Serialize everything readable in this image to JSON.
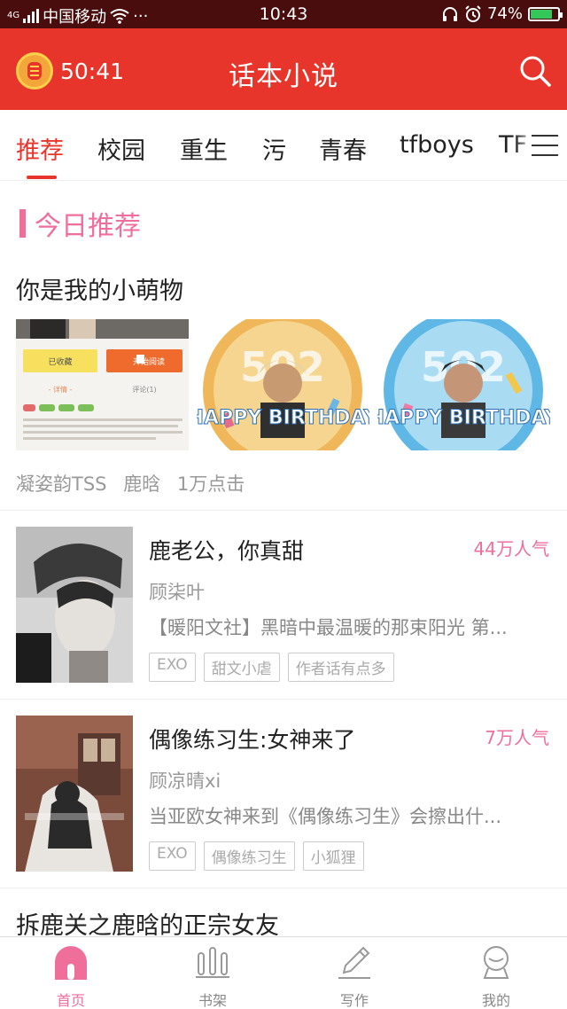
{
  "status_bar": {
    "network": "4G",
    "carrier": "中国移动",
    "more": "···",
    "time": "10:43",
    "battery_percent": "74%",
    "battery_level": 0.74
  },
  "app_bar": {
    "timer": "50:41",
    "title": "话本小说"
  },
  "tabs": [
    {
      "label": "推荐",
      "active": true
    },
    {
      "label": "校园"
    },
    {
      "label": "重生"
    },
    {
      "label": "污"
    },
    {
      "label": "青春"
    },
    {
      "label": "tfboys"
    },
    {
      "label": "TF"
    }
  ],
  "section": {
    "title": "今日推荐"
  },
  "featured": {
    "title": "你是我的小萌物",
    "author": "凝姿韵TSS",
    "tag": "鹿晗",
    "clicks": "1万点击",
    "thumbnails": [
      {
        "button_collected": "已收藏",
        "button_read": "开始阅读",
        "tab_detail": "- 详情 -",
        "tab_comment": "评论(1)"
      },
      {
        "caption": "HAPPY BIRTHDAY",
        "number": "502"
      },
      {
        "caption": "HAPPY BIRTHDAY",
        "number": "502"
      }
    ]
  },
  "books": [
    {
      "title": "鹿老公，你真甜",
      "popularity": "44万人气",
      "author": "顾柒叶",
      "description": "【暖阳文社】黑暗中最温暖的那束阳光 第...",
      "tags": [
        "EXO",
        "甜文小虐",
        "作者话有点多"
      ]
    },
    {
      "title": "偶像练习生:女神来了",
      "popularity": "7万人气",
      "author": "顾凉晴xi",
      "description": "当亚欧女神来到《偶像练习生》会擦出什...",
      "tags": [
        "EXO",
        "偶像练习生",
        "小狐狸"
      ]
    }
  ],
  "partial_book": {
    "title": "拆鹿关之鹿晗的正宗女友"
  },
  "bottom_nav": [
    {
      "label": "首页",
      "icon": "home-icon",
      "active": true
    },
    {
      "label": "书架",
      "icon": "bookshelf-icon"
    },
    {
      "label": "写作",
      "icon": "pen-icon"
    },
    {
      "label": "我的",
      "icon": "profile-icon"
    }
  ],
  "colors": {
    "primary_red": "#e7352b",
    "accent_pink": "#f06e9a"
  }
}
